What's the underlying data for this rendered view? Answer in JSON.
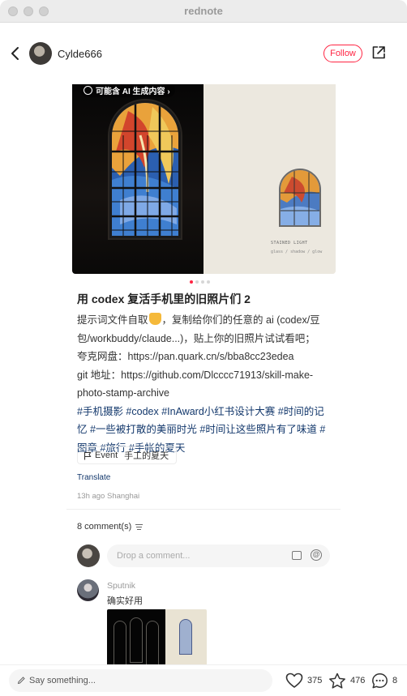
{
  "window": {
    "title": "rednote"
  },
  "author": {
    "name": "Cylde666",
    "follow_label": "Follow"
  },
  "media": {
    "ai_badge": "可能含 AI 生成内容 ›",
    "stamp_title": "STAINED LIGHT",
    "stamp_subtitle": "glass / shadow / glow",
    "page_count": 4,
    "current_page": 1
  },
  "post": {
    "title": "用 codex 复活手机里的旧照片们 2",
    "body_line1_pre": "提示词文件自取",
    "body_line1_post": "，复制给你们的任意的 ai (codex/豆",
    "body_line2": "包/workbuddy/claude...)，贴上你的旧照片试试看吧；",
    "body_line3": "夸克网盘：https://pan.quark.cn/s/bba8cc23edea",
    "body_line4": "git 地址：https://github.com/Dlcccc71913/skill-make-",
    "body_line5": "photo-stamp-archive",
    "tags_line1": "#手机摄影 #codex #InAward小红书设计大赛 #时间的记",
    "tags_line2": "忆 #一些被打散的美丽时光 #时间让这些照片有了味道 #",
    "tags_line3": "图章 #旅行 #手帐的夏天",
    "event_label": "Event",
    "event_name": "手工的夏天",
    "translate_label": "Translate",
    "meta": "13h ago Shanghai"
  },
  "comments": {
    "count_label": "8 comment(s)",
    "input_placeholder": "Drop a comment...",
    "items": [
      {
        "author": "Sputnik",
        "text": "确实好用"
      }
    ]
  },
  "bottom": {
    "say_placeholder": "Say something...",
    "likes": "375",
    "collects": "476",
    "comments": "8"
  },
  "colors": {
    "accent": "#ff2442",
    "tag": "#13386c"
  }
}
